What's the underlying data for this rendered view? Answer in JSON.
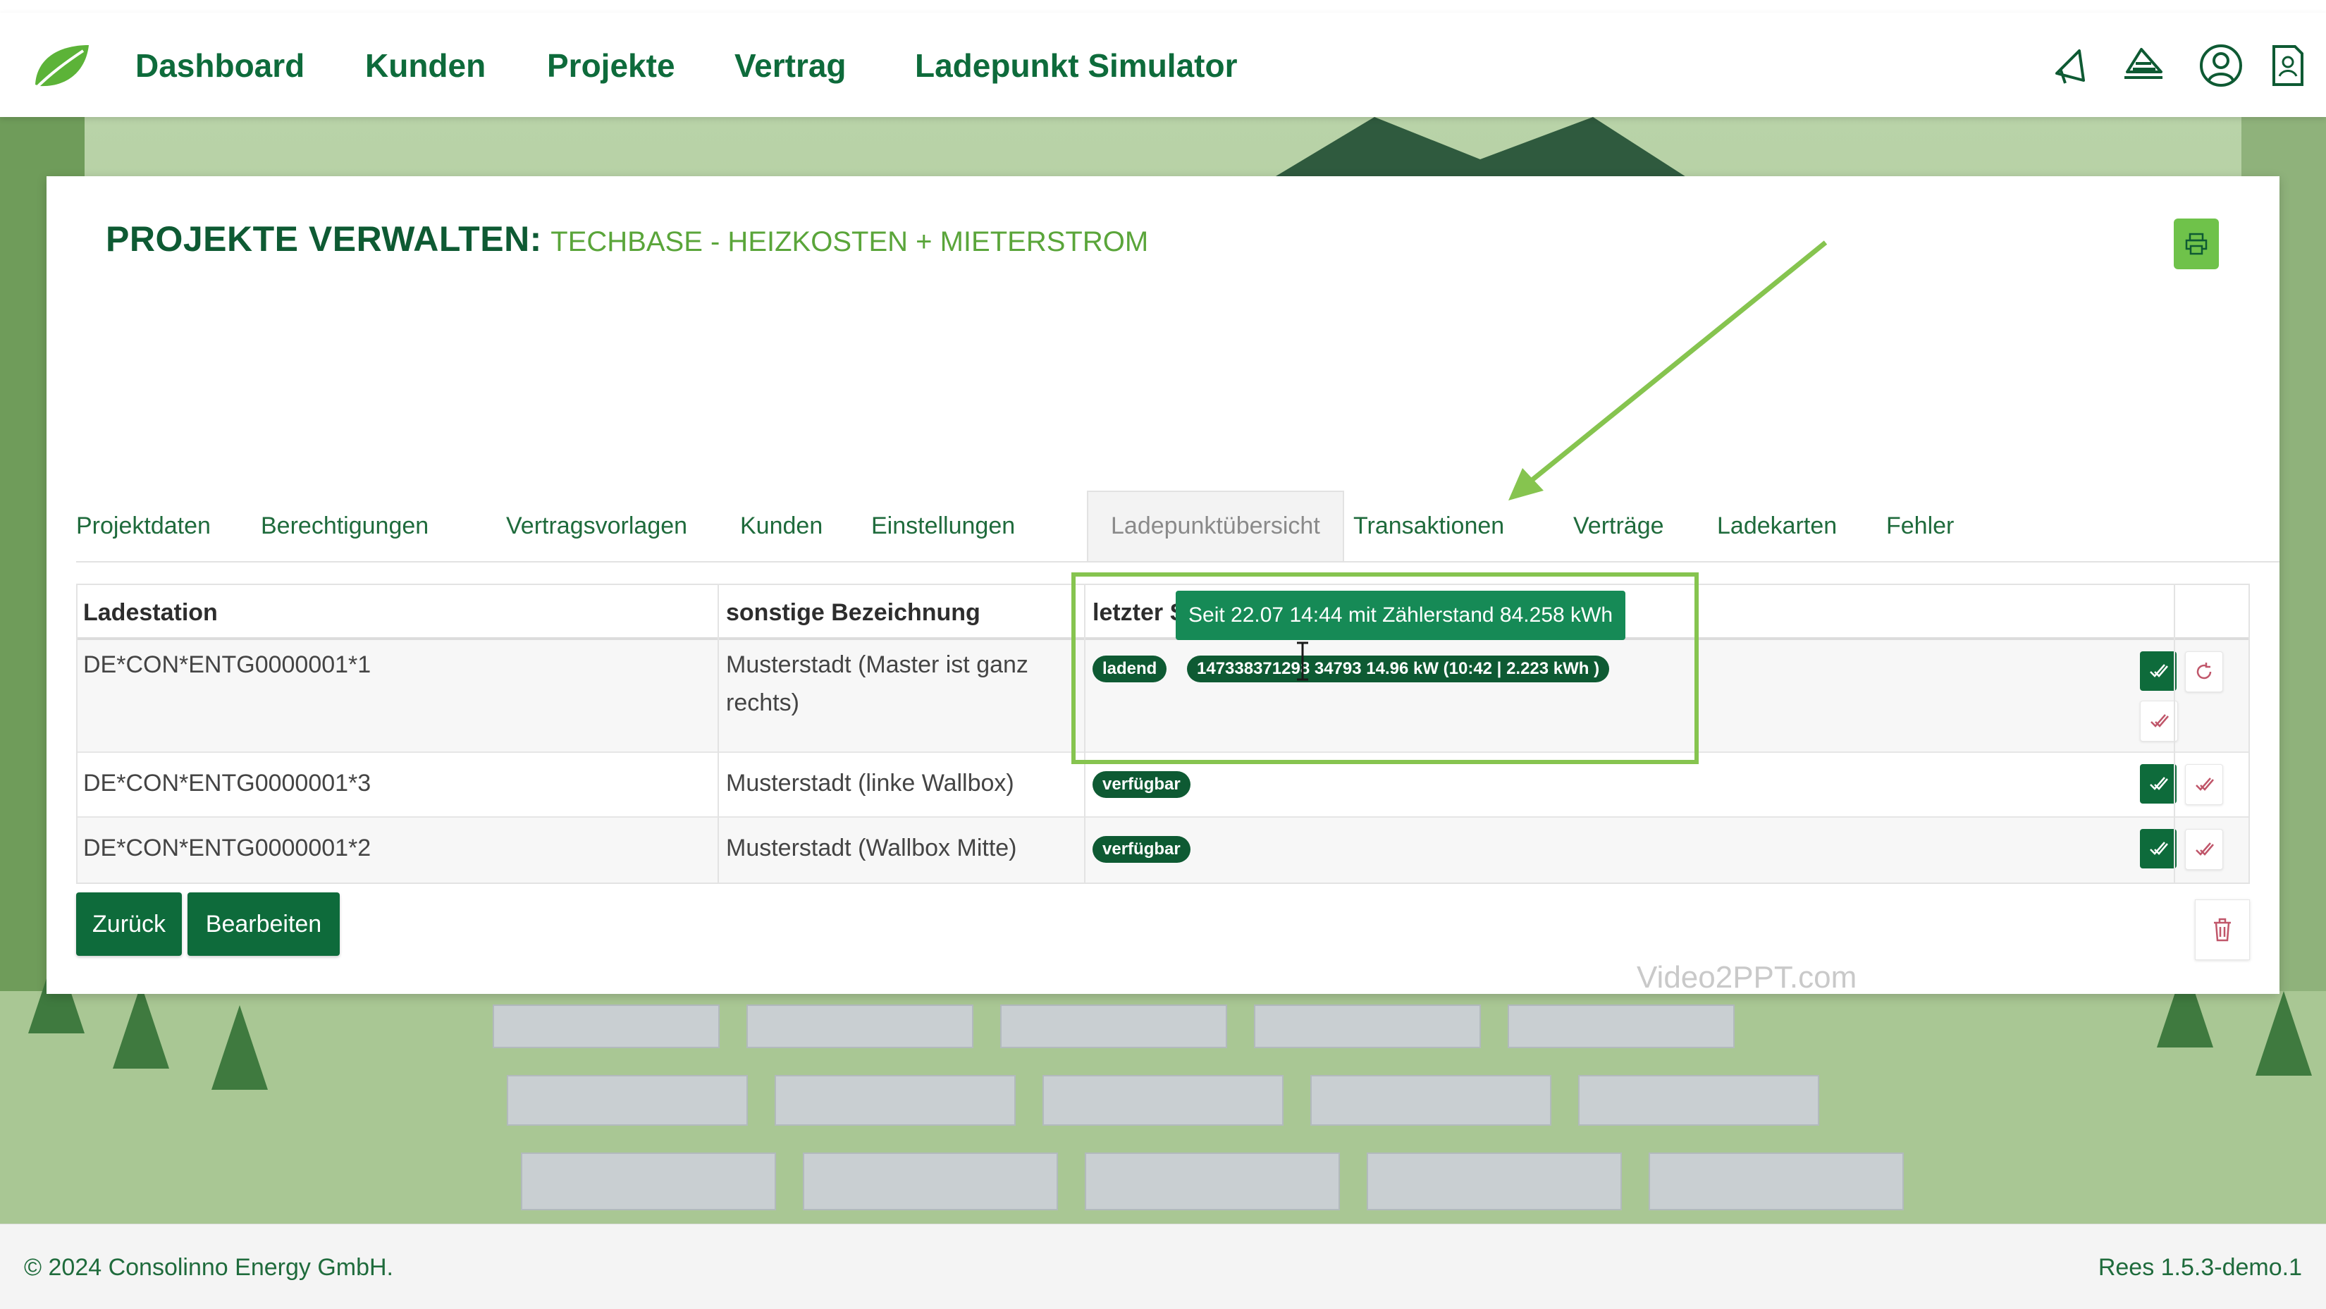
{
  "nav": {
    "items": [
      "Dashboard",
      "Kunden",
      "Projekte",
      "Vertrag",
      "Ladepunkt Simulator"
    ],
    "icons": [
      "megaphone-icon",
      "speed-icon",
      "user-circle-icon",
      "document-user-icon"
    ]
  },
  "page": {
    "title": "PROJEKTE VERWALTEN:",
    "subtitle": "TECHBASE - HEIZKOSTEN + MIETERSTROM"
  },
  "tabs": [
    "Projektdaten",
    "Berechtigungen",
    "Vertragsvorlagen",
    "Kunden",
    "Einstellungen",
    "Ladepunktübersicht",
    "Transaktionen",
    "Verträge",
    "Ladekarten",
    "Fehler"
  ],
  "active_tab": "Ladepunktübersicht",
  "table": {
    "headers": [
      "Ladestation",
      "sonstige Bezeichnung",
      "letzter S"
    ],
    "rows": [
      {
        "station": "DE*CON*ENTG0000001*1",
        "bezeichnung_line1": "Musterstadt (Master ist ganz",
        "bezeichnung_line2": "rechts)",
        "status": "ladend",
        "detail": "147338371298 34793 14.96 kW (10:42 | 2.223 kWh )"
      },
      {
        "station": "DE*CON*ENTG0000001*3",
        "bezeichnung": "Musterstadt (linke Wallbox)",
        "status": "verfügbar"
      },
      {
        "station": "DE*CON*ENTG0000001*2",
        "bezeichnung": "Musterstadt (Wallbox Mitte)",
        "status": "verfügbar"
      }
    ]
  },
  "tooltip": "Seit 22.07 14:44 mit Zählerstand 84.258 kWh",
  "buttons": {
    "back": "Zurück",
    "edit": "Bearbeiten"
  },
  "watermark": "Video2PPT.com",
  "footer": {
    "copyright": "© 2024 Consolinno Energy GmbH.",
    "version": "Rees 1.5.3-demo.1"
  },
  "colors": {
    "brand_dark_green": "#0e6b3b",
    "accent_green": "#6fc24a",
    "tooltip_green": "#168a56",
    "highlight_green": "#86c44f"
  }
}
